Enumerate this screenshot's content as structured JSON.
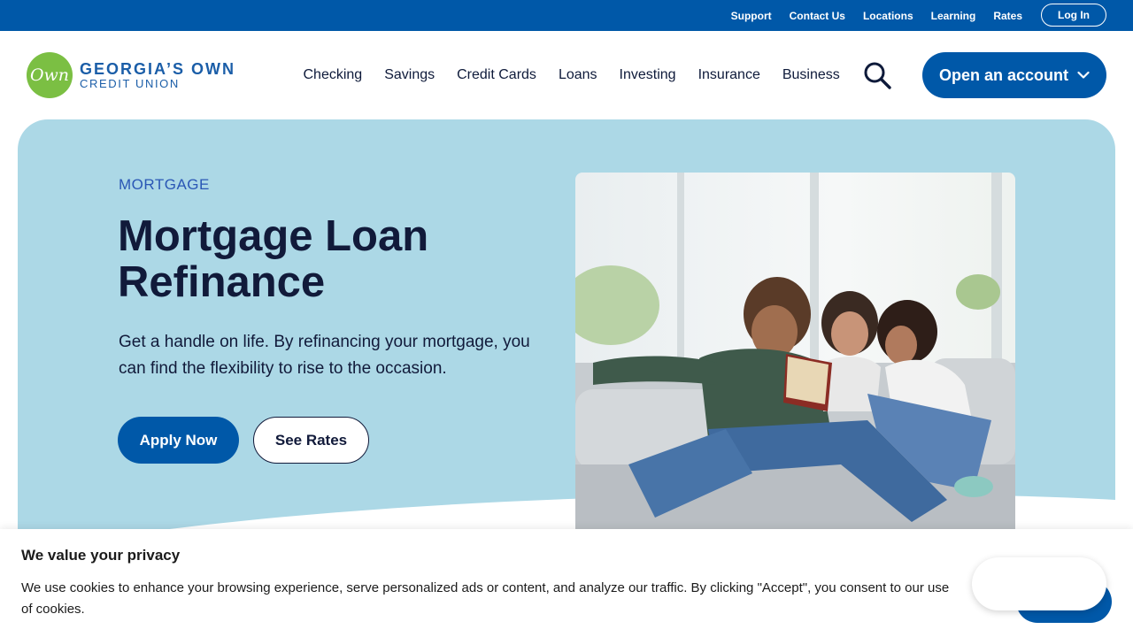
{
  "utility_nav": {
    "links": [
      "Support",
      "Contact Us",
      "Locations",
      "Learning",
      "Rates"
    ],
    "login_label": "Log In"
  },
  "logo": {
    "badge_text": "Own",
    "line1": "GEORGIA’S OWN",
    "line2": "CREDIT UNION"
  },
  "main_nav": {
    "items": [
      "Checking",
      "Savings",
      "Credit Cards",
      "Loans",
      "Investing",
      "Insurance",
      "Business"
    ],
    "search_icon": "search-icon",
    "open_account_label": "Open an account"
  },
  "hero": {
    "eyebrow": "MORTGAGE",
    "title": "Mortgage Loan Refinance",
    "description": "Get a handle on life. By refinancing your mortgage, you can find the flexibility to rise to the occasion.",
    "apply_label": "Apply Now",
    "rates_label": "See Rates"
  },
  "cookie_banner": {
    "title": "We value your privacy",
    "text": "We use cookies to enhance your browsing experience, serve personalized ads or content, and analyze our traffic. By clicking \"Accept\", you consent to our use of cookies.",
    "button_label": ""
  },
  "colors": {
    "brand_blue": "#0058a8",
    "hero_bg": "#acd8e6",
    "logo_green": "#7bbf43",
    "heading": "#111a3a",
    "eyebrow": "#2a57b5"
  }
}
